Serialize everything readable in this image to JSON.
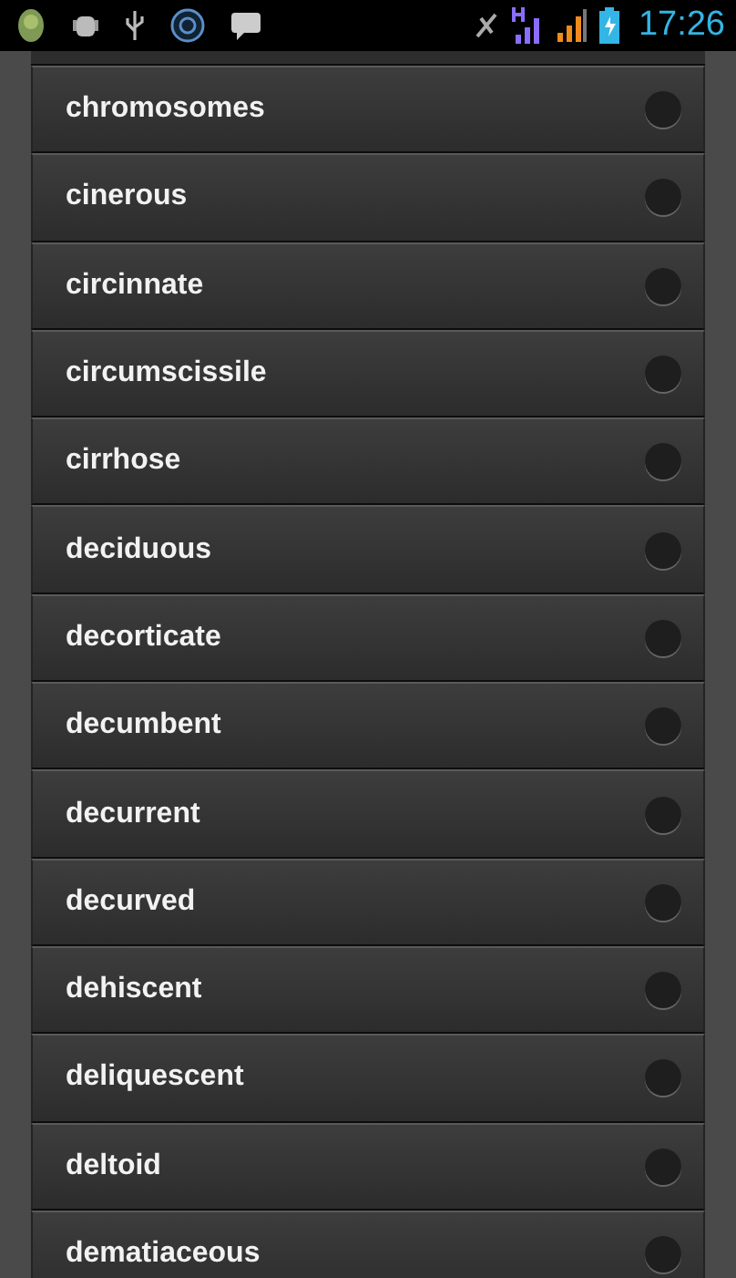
{
  "status_bar": {
    "time": "17:26"
  },
  "items": [
    {
      "label": "chromosomes",
      "selected": false
    },
    {
      "label": "cinerous",
      "selected": false
    },
    {
      "label": "circinnate",
      "selected": false
    },
    {
      "label": "circumscissile",
      "selected": false
    },
    {
      "label": "cirrhose",
      "selected": false
    },
    {
      "label": "deciduous",
      "selected": false
    },
    {
      "label": "decorticate",
      "selected": false
    },
    {
      "label": "decumbent",
      "selected": false
    },
    {
      "label": "decurrent",
      "selected": false
    },
    {
      "label": "decurved",
      "selected": false
    },
    {
      "label": "dehiscent",
      "selected": false
    },
    {
      "label": "deliquescent",
      "selected": false
    },
    {
      "label": "deltoid",
      "selected": false
    },
    {
      "label": "dematiaceous",
      "selected": false
    }
  ]
}
